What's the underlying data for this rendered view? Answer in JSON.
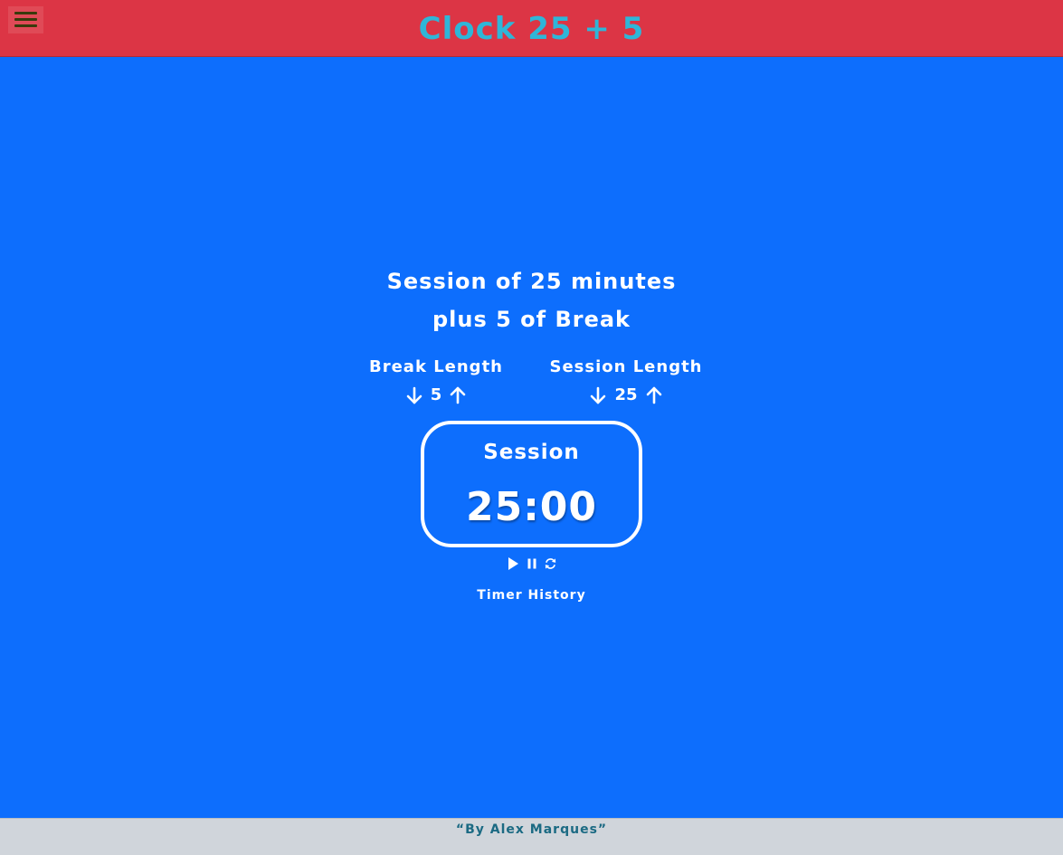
{
  "header": {
    "title": "Clock 25 + 5",
    "menu_icon": "hamburger-menu-icon",
    "background_color": "#dc3545",
    "title_color": "#2fb6d8"
  },
  "main": {
    "background_color": "#0d6efd",
    "headline_line1": "Session of 25 minutes",
    "headline_line2": "plus 5 of Break",
    "break": {
      "label": "Break Length",
      "value": "5",
      "decrement_icon": "arrow-down-icon",
      "increment_icon": "arrow-up-icon"
    },
    "session": {
      "label": "Session Length",
      "value": "25",
      "decrement_icon": "arrow-down-icon",
      "increment_icon": "arrow-up-icon"
    },
    "timer": {
      "label": "Session",
      "time": "25:00"
    },
    "controls": {
      "play_icon": "play-icon",
      "pause_icon": "pause-icon",
      "reset_icon": "refresh-icon"
    },
    "history_link": "Timer History"
  },
  "footer": {
    "text": "“By Alex Marques”",
    "background_color": "#d0d5db",
    "text_color": "#1b6a83"
  }
}
